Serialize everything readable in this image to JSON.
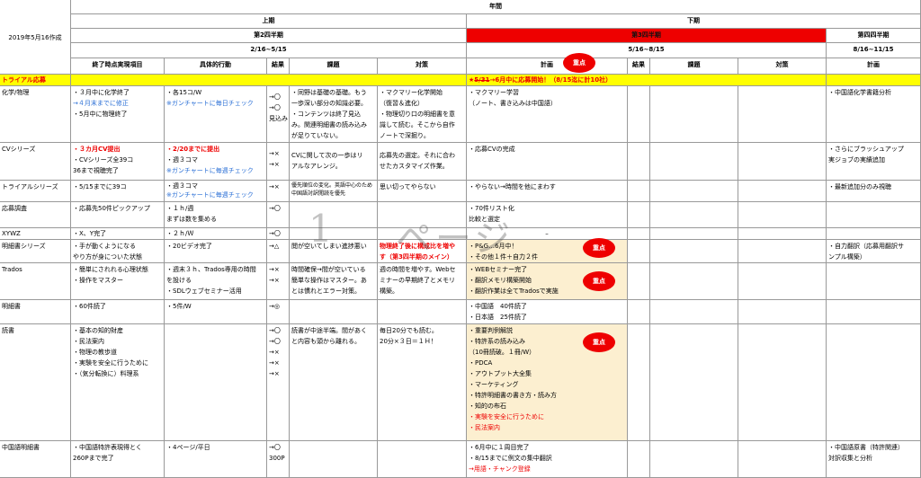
{
  "header": {
    "created": "2019年5月16作成",
    "annual": "年間",
    "first_half": "上期",
    "second_half": "下期",
    "q2": "第2四半期",
    "q3": "第3四半期",
    "q4": "第四四半期",
    "q2_range": "2/16~5/15",
    "q3_range": "5/16~8/15",
    "q4_range": "8/16~11/15"
  },
  "columns": {
    "c1": "終了時点実現項目",
    "c2": "具体的行動",
    "c3": "結果",
    "c4": "課題",
    "c5": "対策",
    "c6": "計画",
    "c7": "結果",
    "c8": "課題",
    "c9": "対策",
    "c10": "計画"
  },
  "trial": {
    "label": "トライアル応募",
    "plan_strike": "5/31",
    "plan_text": "→6月中に応募開始！（8/15迄に計10社）",
    "star": "★"
  },
  "badges": {
    "b1": "重点",
    "b2": "重点",
    "b3": "重点",
    "b4": "重点"
  },
  "watermark": {
    "c1": "1",
    "c2": "ページ"
  },
  "rows": {
    "chem": {
      "name": "化学/物理",
      "a1": "・３月中に化学終了",
      "a2": "→４月末までに修正",
      "a3": "・5月中に物理終了",
      "b1": "・各15コ/W",
      "b2": "※ガンチャートに毎日チェック",
      "r1": "→〇",
      "r2": "→〇",
      "r3": "見込み",
      "i1": "・同野は基礎の基礎。もう",
      "i2": "一歩深い部分の知識必要。",
      "i3": "・コンテンツは終了見込",
      "i4": "み。関連明細書の読み込み",
      "i5": "が足りていない。",
      "m1": "・マクマリー化学開始",
      "m2": "（復習＆進化）",
      "m3": "・物理切り口の明細書を意",
      "m4": "識して読む。そこから自作",
      "m5": "ノートで深掘り。",
      "p1": "・マクマリー学習",
      "p2": "（ノート、書き込みは中国語）",
      "q1": "・中国語化学書籍分析"
    },
    "cv": {
      "name": "CVシリーズ",
      "a1": "・３カ月CV提出",
      "a2": "・CVシリーズ全39コ",
      "a3": "36まで視聴完了",
      "b1": "・2/20までに提出",
      "b2": "・週３コマ",
      "b3": "※ガンチャートに毎週チェック",
      "r1": "→×",
      "r2": "→×",
      "i1": "CVに関して次の一歩はリ",
      "i2": "アルなアレンジ。",
      "m1": "応募先の選定。それに合わ",
      "m2": "せたカスタマイズ作業。",
      "p1": "・応募CVの完成",
      "q1": "・さらにブラッシュアップ",
      "q2": "実ジョブの実績追加"
    },
    "trialseries": {
      "name": "トライアルシリーズ",
      "a1": "・5/15までに39コ",
      "b1": "・週３コマ",
      "b2": "※ガンチャートに毎週チェック",
      "r1": "→×",
      "i1": "優先順位の変化。英語中心のため",
      "i2": "中国語対訳閲読を優先",
      "m1": "思い切ってやらない",
      "p1": "・やらない→時間を他にまわす",
      "q1": "・最新追加分のみ視聴"
    },
    "survey": {
      "name": "応募調査",
      "a1": "・応募先50件ピックアップ",
      "b1": "・１ｈ/週",
      "b2": "まずは数を集める",
      "r1": "→〇",
      "p1": "・70件リスト化",
      "p2": "比較と選定"
    },
    "xywz": {
      "name": "XYWZ",
      "a1": "・X、Y完了",
      "b1": "・２ｈ/Ｗ",
      "r1": "→〇",
      "p1": "–"
    },
    "spec": {
      "name": "明細書シリーズ",
      "a1": "・手が動くようになる",
      "a2": "やり方が身についた状態",
      "b1": "・20ビデオ完了",
      "r1": "→△",
      "i1": "閲が空いてしまい進捗悪い",
      "m1": "物理終了後に構成比を増や",
      "m2": "す（第3四半期のメイン）",
      "p1": "・P&G…6月中！",
      "p2": "・その他１件＋自力２件",
      "q1": "・自力翻訳（応募用翻訳サ",
      "q2": "ンプル構築）"
    },
    "trados": {
      "name": "Trados",
      "a1": "・簡単にされれる心理状態",
      "a2": "・操作をマスター",
      "b1": "・週末３ｈ、Trados専用の時間",
      "b2": "を設ける",
      "b3": "・SDLウェブセミナー活用",
      "r1": "→×",
      "r2": "→×",
      "i1": "時間確保→間が空いている",
      "i2": "簡単な操作はマスター。あ",
      "i3": "とは慣れとエラー対策。",
      "m1": "週の時間を増やす。Webセ",
      "m2": "ミナーの早期終了とメモリ",
      "m3": "構築。",
      "p1": "・WEBセミナー完了",
      "p2": "・翻訳メモリ構築開始",
      "p3": "・翻訳作業は全てTradosで実施"
    },
    "meisai": {
      "name": "明細書",
      "a1": "・60件読了",
      "b1": "・5件/W",
      "r1": "→◎",
      "p1": "・中国語　40件読了",
      "p2": "・日本語　25件読了"
    },
    "reading": {
      "name": "読書",
      "a1": "・基本の知的財産",
      "a2": "・民法案内",
      "a3": "・物理の教歩道",
      "a4": "・実験を安全に行うために",
      "a5": "・（気分転換に）料理系",
      "r1": "→〇",
      "r2": "→〇",
      "r3": "→×",
      "r4": "→×",
      "r5": "→×",
      "i1": "読書が中途半端。間があく",
      "i2": "と内容も頭から離れる。",
      "m1": "毎日20分でも読む。",
      "m2": "20分×３日＝１Ｈ！",
      "p1": "・重要判例解説",
      "p2": "・特許系の読み込み",
      "p3": "（10冊読破。１冊/W）",
      "p4": "・PDCA",
      "p5": "・アウトプット大全集",
      "p6": "・マーケティング",
      "p7": "・特許明細書の書き方・読み方",
      "p8": "・知的の布石",
      "p9": "・実験を安全に行うために",
      "p10": "・民法案内"
    },
    "cnspec": {
      "name": "中国語明細書",
      "a1": "・中国語特許表現得とく",
      "a2": "260Pまで完了",
      "b1": "・4ページ/平日",
      "r1": "→〇",
      "r2": "300P",
      "p1": "・6月中に１周目完了",
      "p2": "・8/15までに例文の集中翻訳",
      "p3": "→用語・チャンク登録",
      "q1": "・中国語原書（特許関連）",
      "q2": "対訳収集と分析"
    }
  }
}
